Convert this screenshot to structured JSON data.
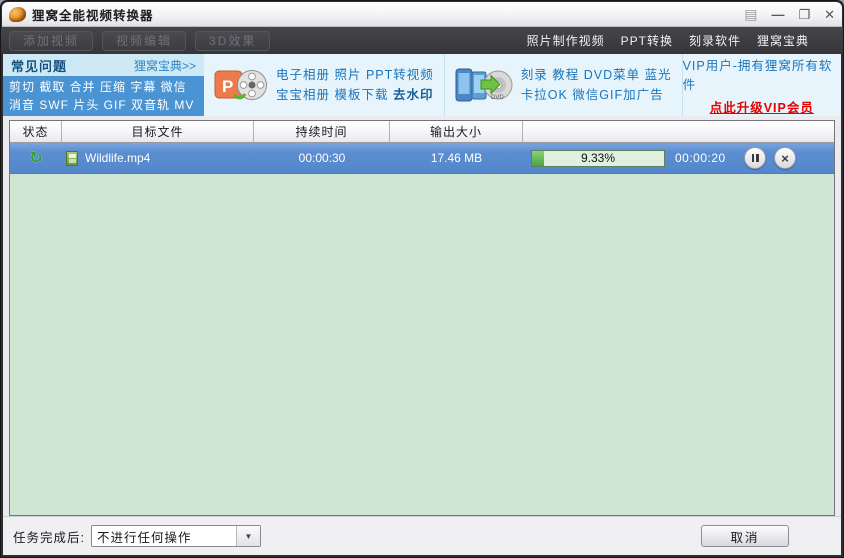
{
  "window": {
    "title": "狸窝全能视频转换器",
    "controls": {
      "menu": "▤",
      "minimize": "—",
      "maximize": "❐",
      "close": "✕"
    }
  },
  "toolbar": {
    "buttons": [
      {
        "label": "添加视频"
      },
      {
        "label": "视频编辑"
      },
      {
        "label": "3D效果"
      }
    ],
    "menu_items": [
      {
        "label": "照片制作视频"
      },
      {
        "label": "PPT转换"
      },
      {
        "label": "刻录软件"
      },
      {
        "label": "狸窝宝典"
      }
    ]
  },
  "promo": {
    "faq": {
      "title": "常见问题",
      "link": "狸窝宝典>>",
      "tags_line1": "剪切 截取 合并 压缩 字幕 微信",
      "tags_line2": "消音 SWF 片头 GIF 双音轨 MV"
    },
    "ppt_section": {
      "line1": "电子相册 照片 PPT转视频",
      "line2_normal": "宝宝相册 模板下载 ",
      "line2_bold": "去水印"
    },
    "burn_section": {
      "line1": "刻录 教程 DVD菜单 蓝光",
      "line2": "卡拉OK 微信GIF加广告"
    },
    "vip": {
      "line1": "VIP用户-拥有狸窝所有软件",
      "link": "点此升级VIP会员"
    }
  },
  "table": {
    "columns": [
      "状态",
      "目标文件",
      "持续时间",
      "输出大小",
      ""
    ],
    "rows": [
      {
        "filename": "Wildlife.mp4",
        "duration": "00:00:30",
        "output_size": "17.46 MB",
        "progress_percent": "9.33%",
        "progress_value": 9.33,
        "elapsed": "00:00:20"
      }
    ]
  },
  "footer": {
    "after_task_label": "任务完成后:",
    "after_task_value": "不进行任何操作",
    "cancel_label": "取消"
  },
  "colors": {
    "selected_row_blue": "#5b8ed1",
    "progress_green": "#4aa53e",
    "vip_link_red": "#e60000",
    "promo_text_blue": "#1a75bc",
    "tags_box_blue": "#4a94d4"
  }
}
